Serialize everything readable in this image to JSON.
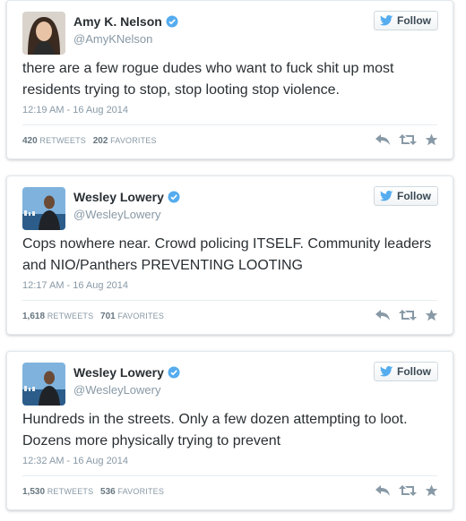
{
  "follow_label": "Follow",
  "tweets": [
    {
      "name": "Amy K. Nelson",
      "handle": "@AmyKNelson",
      "text": "there are a few rogue dudes who want to fuck shit up most residents trying to stop, stop looting stop violence.",
      "time": "12:19 AM - 16 Aug 2014",
      "retweets": "420",
      "retweets_label": "RETWEETS",
      "favorites": "202",
      "favorites_label": "FAVORITES"
    },
    {
      "name": "Wesley Lowery",
      "handle": "@WesleyLowery",
      "text": "Cops nowhere near. Crowd policing ITSELF. Community leaders and NIO/Panthers PREVENTING LOOTING",
      "time": "12:17 AM - 16 Aug 2014",
      "retweets": "1,618",
      "retweets_label": "RETWEETS",
      "favorites": "701",
      "favorites_label": "FAVORITES"
    },
    {
      "name": "Wesley Lowery",
      "handle": "@WesleyLowery",
      "text": "Hundreds in the streets. Only a few dozen attempting to loot. Dozens more physically trying to prevent",
      "time": "12:32 AM - 16 Aug 2014",
      "retweets": "1,530",
      "retweets_label": "RETWEETS",
      "favorites": "536",
      "favorites_label": "FAVORITES"
    }
  ],
  "colors": {
    "verified": "#55acee",
    "twitter_bird": "#55acee",
    "action_icons": "#8899a6"
  },
  "icons": [
    "verified-badge-icon",
    "twitter-bird-icon",
    "reply-icon",
    "retweet-icon",
    "favorite-star-icon"
  ]
}
